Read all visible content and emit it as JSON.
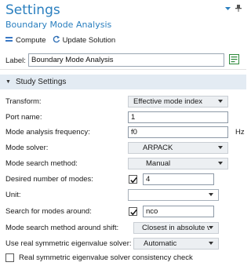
{
  "header": {
    "title": "Settings",
    "subtitle": "Boundary Mode Analysis",
    "compute_label": "Compute",
    "update_label": "Update Solution"
  },
  "label_field": {
    "label": "Label:",
    "value": "Boundary Mode Analysis"
  },
  "section": {
    "title": "Study Settings"
  },
  "settings": {
    "transform": {
      "label": "Transform:",
      "value": "Effective mode index"
    },
    "port_name": {
      "label": "Port name:",
      "value": "1"
    },
    "mode_freq": {
      "label": "Mode analysis frequency:",
      "value": "f0",
      "unit": "Hz"
    },
    "mode_solver": {
      "label": "Mode solver:",
      "value": "ARPACK"
    },
    "mode_search_method": {
      "label": "Mode search method:",
      "value": "Manual"
    },
    "desired_modes": {
      "label": "Desired number of modes:",
      "value": "4",
      "checked": true
    },
    "unit": {
      "label": "Unit:",
      "value": ""
    },
    "search_around": {
      "label": "Search for modes around:",
      "value": "nco",
      "checked": true
    },
    "search_shift": {
      "label": "Mode search method around shift:",
      "value": "Closest in absolute v"
    },
    "real_symmetric": {
      "label": "Use real symmetric eigenvalue solver:",
      "value": "Automatic"
    },
    "consistency_check": {
      "label": "Real symmetric eigenvalue solver consistency check",
      "checked": false
    }
  },
  "colors": {
    "title": "#2a7fbf",
    "section_bg": "#e3ebf3",
    "compute_icon": "#3a78c4",
    "update_icon": "#2f6fb5",
    "edit_icon": "#2f8a3c"
  },
  "icons": {
    "compute": "compute-icon",
    "update": "update-solution-icon",
    "pin": "pin-icon",
    "collapse": "chevron-down-icon",
    "edit": "edit-label-icon"
  }
}
